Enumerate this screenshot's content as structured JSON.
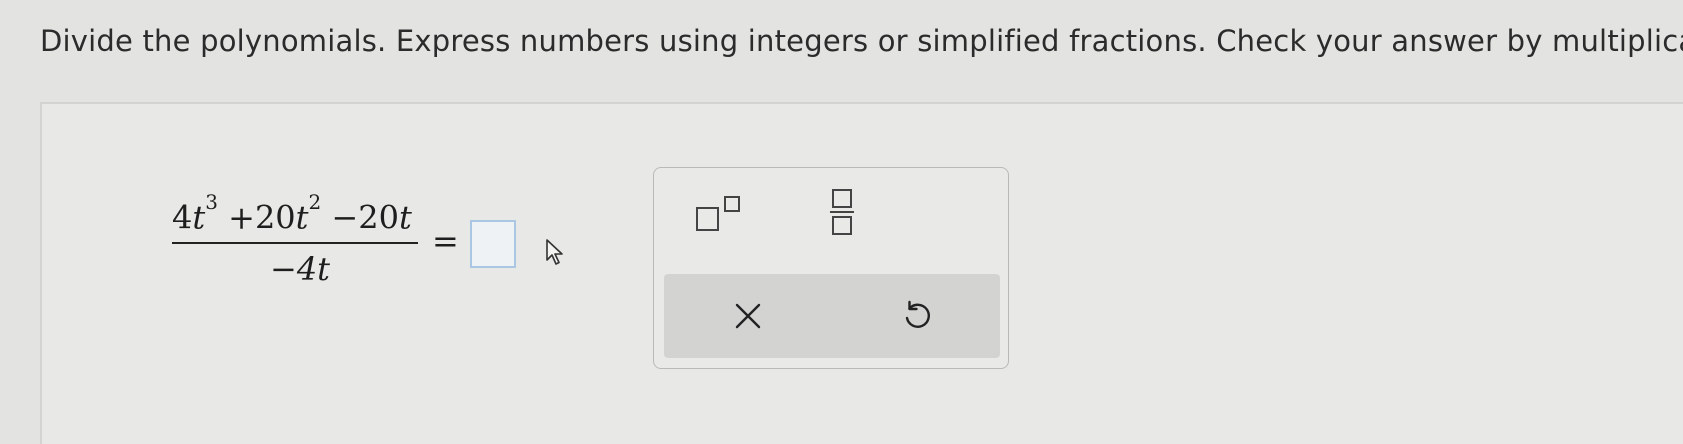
{
  "instruction": "Divide the polynomials. Express numbers using integers or simplified fractions. Check your answer by multiplication.",
  "expression": {
    "numerator": {
      "term1_coef": "4",
      "term1_var": "t",
      "term1_exp": "3",
      "term2_coef": "+20",
      "term2_var": "t",
      "term2_exp": "2",
      "term3_coef": "−20",
      "term3_var": "t"
    },
    "denominator": "−4t",
    "equals": "="
  },
  "answer": {
    "value": ""
  },
  "palette": {
    "tools": [
      "exponent-template-icon",
      "fraction-template-icon"
    ],
    "actions": [
      "clear-icon",
      "undo-icon"
    ]
  },
  "colors": {
    "answer_box_border": "#a9c6e2",
    "action_bar": "#d3d3d1"
  }
}
